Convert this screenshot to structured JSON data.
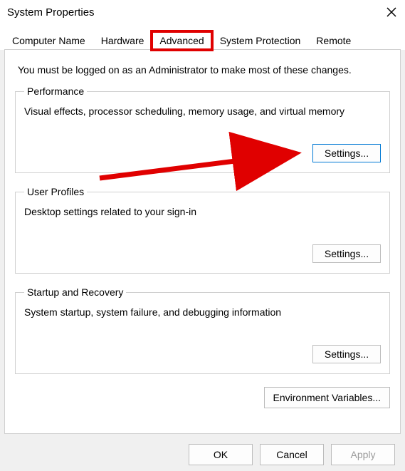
{
  "window": {
    "title": "System Properties"
  },
  "tabs": {
    "computer_name": "Computer Name",
    "hardware": "Hardware",
    "advanced": "Advanced",
    "system_protection": "System Protection",
    "remote": "Remote"
  },
  "intro": "You must be logged on as an Administrator to make most of these changes.",
  "groups": {
    "performance": {
      "legend": "Performance",
      "desc": "Visual effects, processor scheduling, memory usage, and virtual memory",
      "button": "Settings..."
    },
    "user_profiles": {
      "legend": "User Profiles",
      "desc": "Desktop settings related to your sign-in",
      "button": "Settings..."
    },
    "startup_recovery": {
      "legend": "Startup and Recovery",
      "desc": "System startup, system failure, and debugging information",
      "button": "Settings..."
    }
  },
  "env_button": "Environment Variables...",
  "footer": {
    "ok": "OK",
    "cancel": "Cancel",
    "apply": "Apply"
  },
  "annotation": {
    "highlight_tab": "advanced",
    "arrow_target": "performance_settings"
  }
}
